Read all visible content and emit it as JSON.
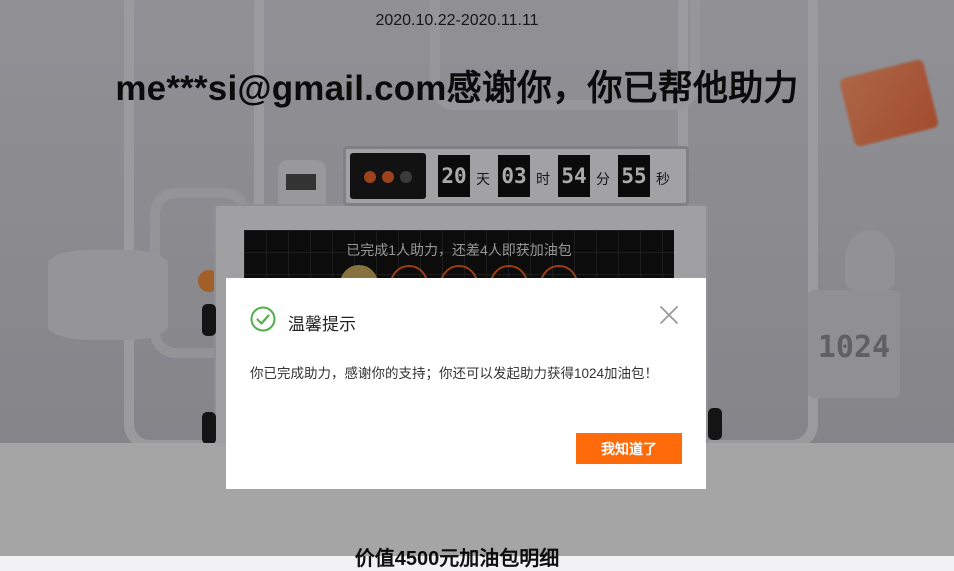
{
  "campaign": {
    "date_range": "2020.10.22-2020.11.11",
    "headline": "me***si@gmail.com感谢你，你已帮他助力"
  },
  "countdown": {
    "days": "20",
    "days_unit": "天",
    "hours": "03",
    "hours_unit": "时",
    "minutes": "54",
    "minutes_unit": "分",
    "seconds": "55",
    "seconds_unit": "秒"
  },
  "progress": {
    "text": "已完成1人助力，还差4人即获加油包",
    "completed": 1,
    "total": 5
  },
  "decor": {
    "weight_label": "1024"
  },
  "dialog": {
    "title": "温馨提示",
    "message": "你已完成助力，感谢你的支持；你还可以发起助力获得1024加油包！",
    "confirm_label": "我知道了",
    "icons": {
      "status": "check-circle-icon",
      "close": "close-icon"
    }
  },
  "section": {
    "title": "价值4500元加油包明细"
  },
  "colors": {
    "accent": "#ff6a0a",
    "success": "#52b04a",
    "slot_border": "#e05a1a",
    "slot_filled": "#c2a25a"
  }
}
